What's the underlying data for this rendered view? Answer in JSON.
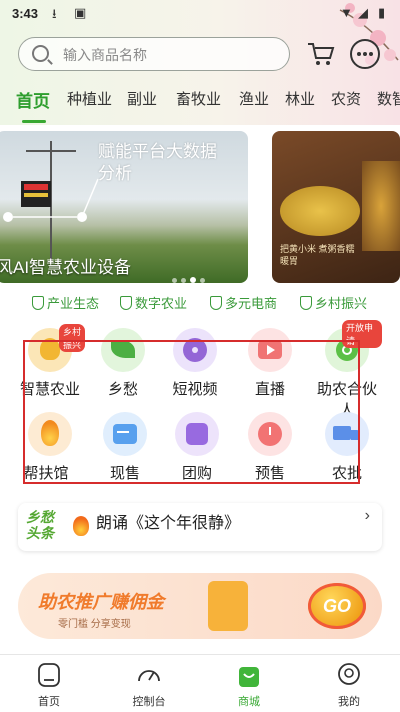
{
  "status_bar": {
    "time": "3:43"
  },
  "search": {
    "placeholder": "输入商品名称"
  },
  "tabs": [
    "首页",
    "种植业",
    "副业",
    "畜牧业",
    "渔业",
    "林业",
    "农资",
    "数智"
  ],
  "banner_left": {
    "title": "赋能平台大数据分析",
    "caption": "风AI智慧农业设备"
  },
  "banner_right": {
    "text": "把黄小米 煮粥香糯暖胃"
  },
  "features": [
    "产业生态",
    "数字农业",
    "多元电商",
    "乡村振兴"
  ],
  "grid": [
    {
      "label": "智慧农业",
      "icon": "smart-agriculture-icon",
      "badge": "乡村振兴",
      "color": "#f7d27a"
    },
    {
      "label": "乡愁",
      "icon": "leaf-icon",
      "color": "#55b84a"
    },
    {
      "label": "短视频",
      "icon": "film-reel-icon",
      "color": "#9b6fd8"
    },
    {
      "label": "直播",
      "icon": "live-stream-icon",
      "color": "#f07a7a"
    },
    {
      "label": "助农合伙人",
      "icon": "partner-icon",
      "badge": "开放申请",
      "color": "#61c24a"
    },
    {
      "label": "帮扶馆",
      "icon": "flame-icon",
      "color": "#f39b35"
    },
    {
      "label": "现售",
      "icon": "card-icon",
      "color": "#5aa0ee"
    },
    {
      "label": "团购",
      "icon": "puzzle-icon",
      "color": "#9a6ee0"
    },
    {
      "label": "预售",
      "icon": "alarm-clock-icon",
      "color": "#f27373"
    },
    {
      "label": "农批",
      "icon": "truck-icon",
      "color": "#5b8fe8"
    }
  ],
  "news": {
    "logo": "乡愁头条",
    "headline": "朗诵《这个年很静》"
  },
  "promo": {
    "title": "助农推广赚佣金",
    "subtitle": "零门槛 分享变现",
    "button": "GO"
  },
  "bottom_nav": [
    {
      "label": "首页",
      "icon": "home-icon"
    },
    {
      "label": "控制台",
      "icon": "dashboard-icon"
    },
    {
      "label": "商城",
      "icon": "shopping-bag-icon",
      "active": true
    },
    {
      "label": "我的",
      "icon": "profile-icon"
    }
  ],
  "colors": {
    "accent": "#38a832",
    "highlight_box": "#d62c2c"
  }
}
